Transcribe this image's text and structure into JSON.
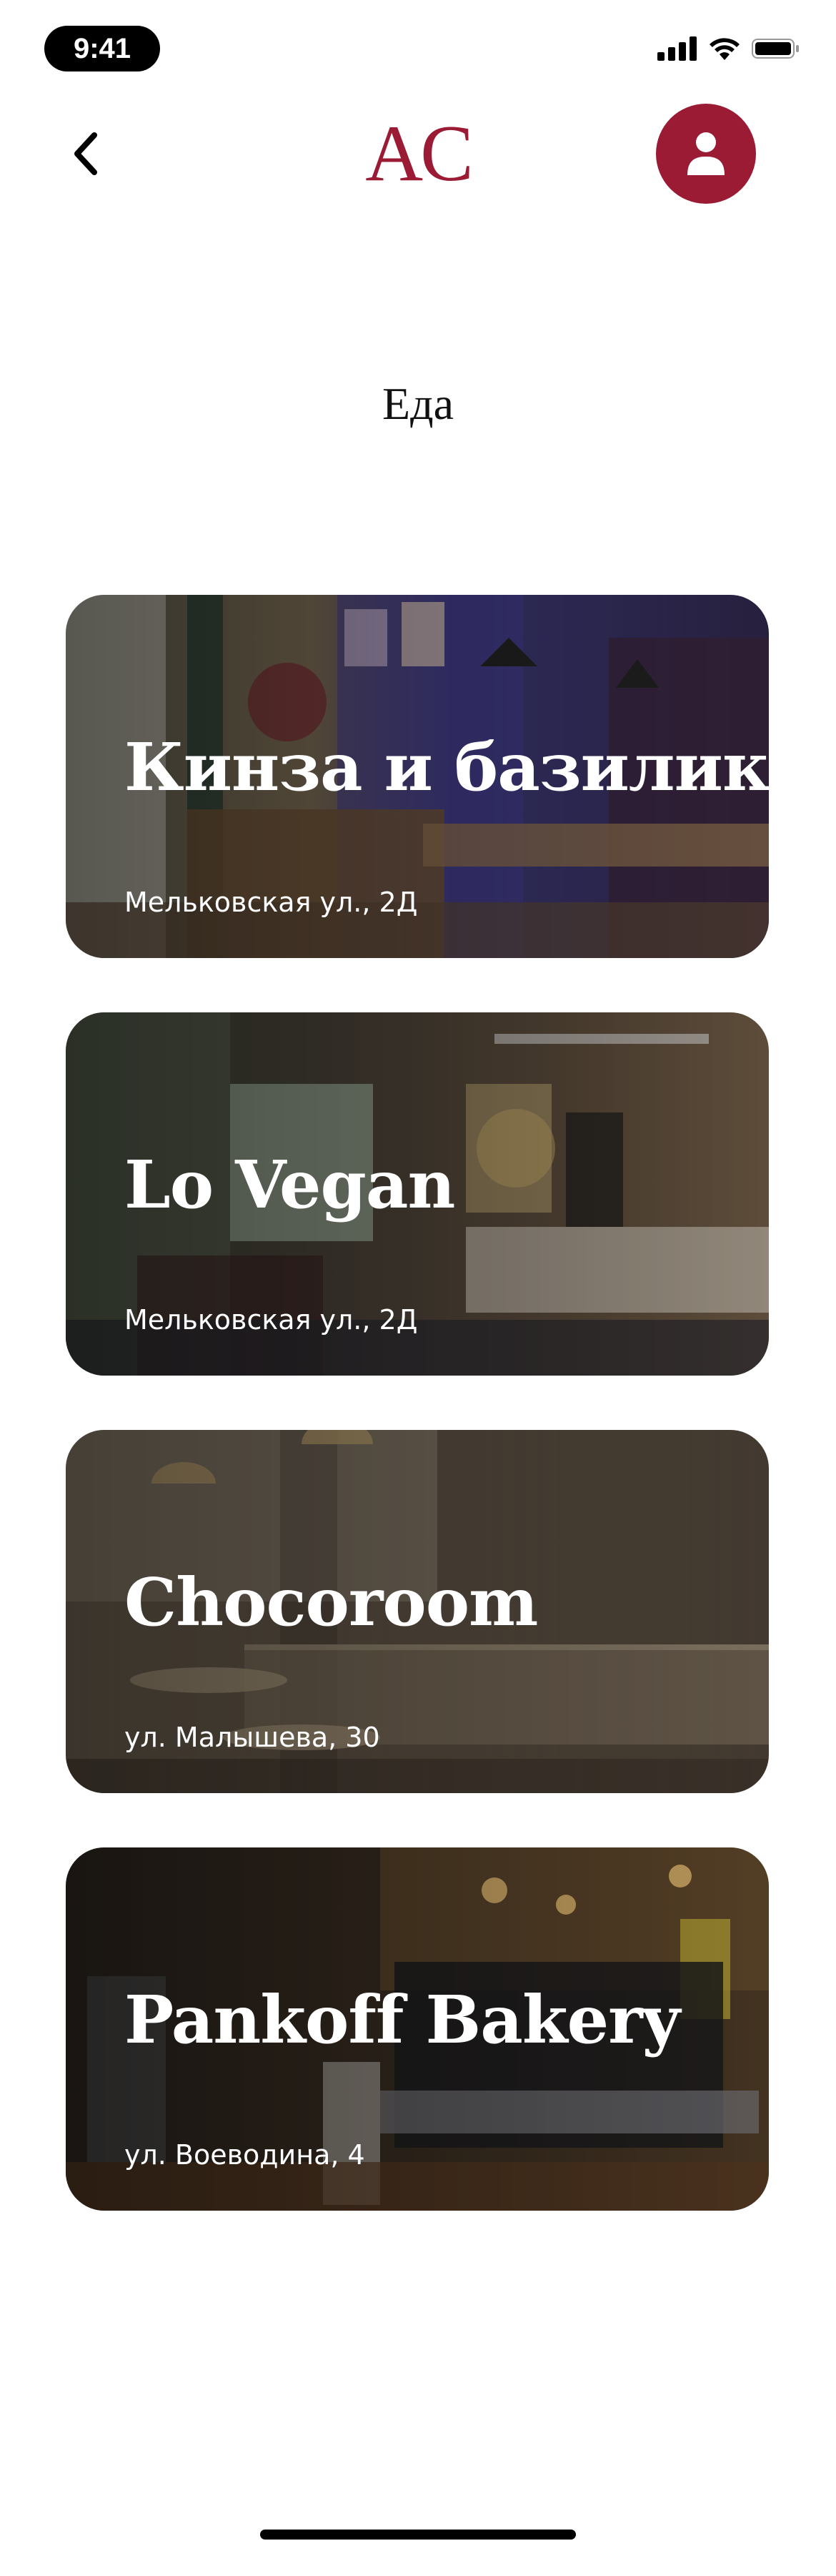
{
  "status_bar": {
    "time": "9:41"
  },
  "header": {
    "logo": "AC",
    "back_icon": "chevron-left-icon",
    "profile_icon": "user-icon",
    "accent_color": "#9b1b34"
  },
  "page": {
    "title": "Еда"
  },
  "places": [
    {
      "name": "Кинза и базилик",
      "address": "Мельковская ул., 2Д"
    },
    {
      "name": "Lo Vegan",
      "address": "Мельковская ул., 2Д"
    },
    {
      "name": "Chocoroom",
      "address": "ул. Малышева, 30"
    },
    {
      "name": "Pankoff Bakery",
      "address": "ул. Воеводина, 4"
    }
  ]
}
